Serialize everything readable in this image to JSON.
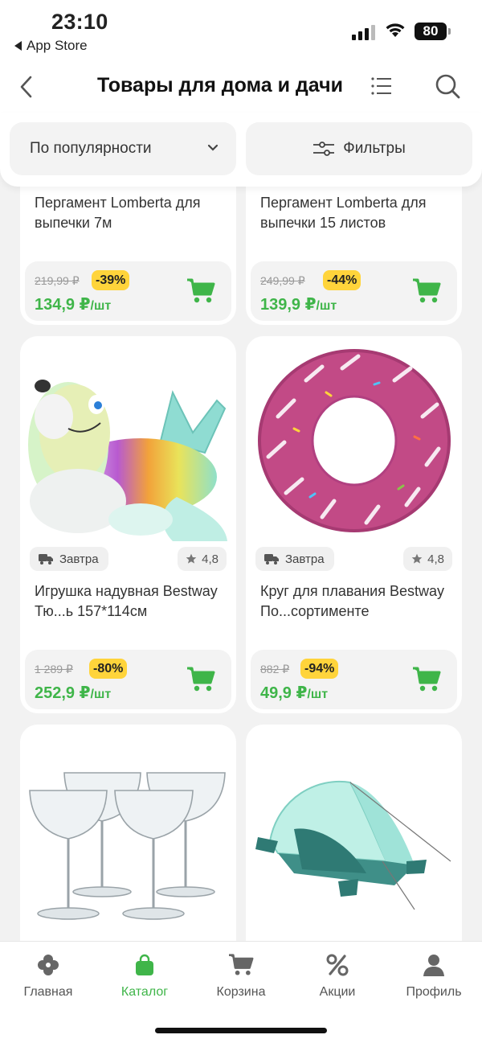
{
  "status_bar": {
    "time": "23:10",
    "back_app": "App Store",
    "battery": "80"
  },
  "header": {
    "title": "Товары для дома и дачи",
    "icons": [
      "back-chevron-icon",
      "list-icon",
      "search-icon"
    ]
  },
  "toolbar": {
    "sort_label": "По популярности",
    "filter_label": "Фильтры"
  },
  "products": [
    {
      "name": "Пергамент Lomberta для выпечки 7м",
      "old_price": "219,99 ₽",
      "discount": "-39%",
      "price": "134,9 ₽",
      "unit": "/шт"
    },
    {
      "name": "Пергамент Lomberta для выпечки 15 листов",
      "old_price": "249,99 ₽",
      "discount": "-44%",
      "price": "139,9 ₽",
      "unit": "/шт"
    },
    {
      "name": "Игрушка надувная Bestway Тю...ь 157*114см",
      "delivery": "Завтра",
      "rating": "4,8",
      "old_price": "1 289 ₽",
      "discount": "-80%",
      "price": "252,9 ₽",
      "unit": "/шт",
      "image": "inflatable-seal-toy"
    },
    {
      "name": "Круг для плавания Bestway По...сортименте",
      "delivery": "Завтра",
      "rating": "4,8",
      "old_price": "882 ₽",
      "discount": "-94%",
      "price": "49,9 ₽",
      "unit": "/шт",
      "image": "donut-swim-ring"
    },
    {
      "image": "champagne-glasses"
    },
    {
      "image": "beach-tent"
    }
  ],
  "tabs": [
    {
      "label": "Главная",
      "icon": "home-icon"
    },
    {
      "label": "Каталог",
      "icon": "catalog-bag-icon",
      "active": true
    },
    {
      "label": "Корзина",
      "icon": "cart-icon"
    },
    {
      "label": "Акции",
      "icon": "percent-icon"
    },
    {
      "label": "Профиль",
      "icon": "profile-icon"
    }
  ],
  "colors": {
    "accent": "#3fb549",
    "discount_badge": "#ffd43b",
    "old_price": "#999999"
  }
}
